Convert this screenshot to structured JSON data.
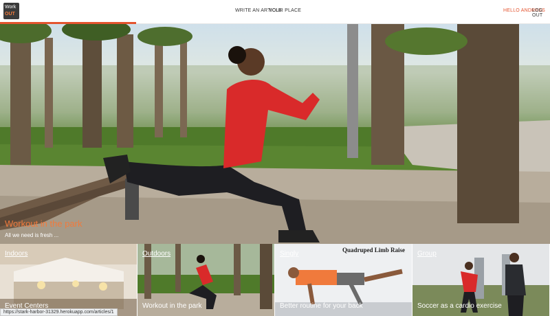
{
  "header": {
    "logo_line1": "Work",
    "logo_line2": "OUT",
    "nav_write": "WRITE AN ARTICLE",
    "nav_place": "YOUR PLACE",
    "nav_hello": "HELLO ANDRESS",
    "nav_logout": "LOG OUT",
    "accent_color": "#e4542f"
  },
  "hero": {
    "title": "Workout in the park",
    "subtitle": "All we need is fresh ..."
  },
  "cards": [
    {
      "category": "Indoors",
      "title": "Event Centers"
    },
    {
      "category": "Outdoors",
      "title": "Workout in the park"
    },
    {
      "category": "Singly",
      "title": "Better routine for your back",
      "image_caption": "Quadruped Limb Raise"
    },
    {
      "category": "Group",
      "title": "Soccer as a cardio exercise"
    }
  ],
  "status_url": "https://stark-harbor-31329.herokuapp.com/articles/1"
}
